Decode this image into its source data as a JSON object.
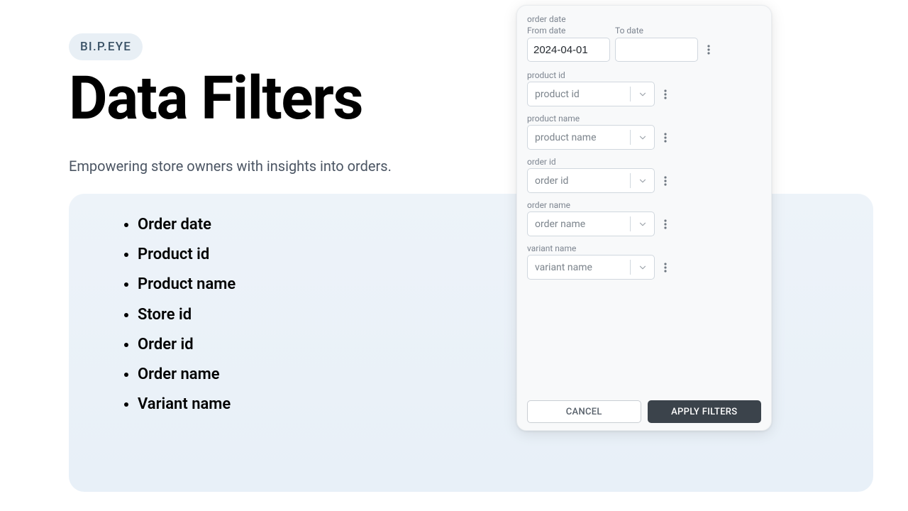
{
  "brand": "BI.P.EYE",
  "title": "Data Filters",
  "subtitle": "Empowering store owners with insights into orders.",
  "bullets": [
    "Order date",
    "Product id",
    "Product name",
    "Store id",
    "Order id",
    "Order name",
    "Variant name"
  ],
  "panel": {
    "date": {
      "section_label": "order date",
      "from_label": "From date",
      "to_label": "To date",
      "from_value": "2024-04-01",
      "to_value": ""
    },
    "selects": [
      {
        "label": "product id",
        "placeholder": "product id",
        "name": "product-id-select"
      },
      {
        "label": "product name",
        "placeholder": "product name",
        "name": "product-name-select"
      },
      {
        "label": "order id",
        "placeholder": "order id",
        "name": "order-id-select"
      },
      {
        "label": "order name",
        "placeholder": "order name",
        "name": "order-name-select"
      },
      {
        "label": "variant name",
        "placeholder": "variant name",
        "name": "variant-name-select"
      }
    ],
    "footer": {
      "cancel": "CANCEL",
      "apply": "APPLY FILTERS"
    }
  }
}
